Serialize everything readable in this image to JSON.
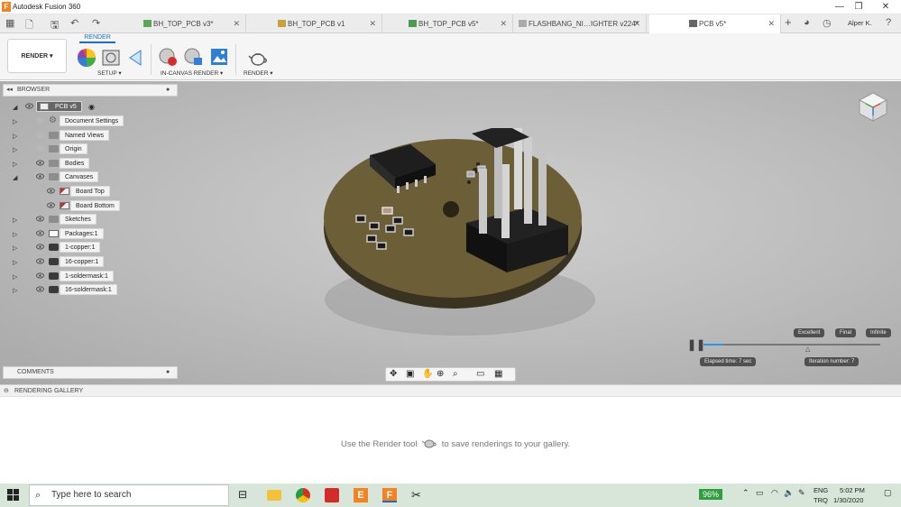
{
  "window": {
    "title": "Autodesk Fusion 360",
    "user": "Alper K.",
    "controls": [
      "—",
      "❐",
      "✕"
    ]
  },
  "tabs": [
    {
      "label": "BH_TOP_PCB v3*",
      "active": false
    },
    {
      "label": "BH_TOP_PCB v1",
      "active": false
    },
    {
      "label": "BH_TOP_PCB v5*",
      "active": false
    },
    {
      "label": "FLASHBANG_NI…IGHTER v224*",
      "active": false
    },
    {
      "label": "PCB v5*",
      "active": true
    }
  ],
  "ribbon": {
    "workspace": "RENDER ▾",
    "active_tab": "RENDER",
    "groups": [
      "SETUP ▾",
      "IN-CANVAS RENDER ▾",
      "RENDER ▾"
    ]
  },
  "browser": {
    "title": "BROWSER",
    "root": "PCB v5",
    "nodes": [
      {
        "label": "Document Settings",
        "icon": "gear-icon"
      },
      {
        "label": "Named Views",
        "icon": "folder-icon"
      },
      {
        "label": "Origin",
        "icon": "folder-icon"
      },
      {
        "label": "Bodies",
        "icon": "folder-icon"
      },
      {
        "label": "Canvases",
        "icon": "folder-icon"
      },
      {
        "label": "Board Top",
        "icon": "canvas-icon"
      },
      {
        "label": "Board Bottom",
        "icon": "canvas-icon"
      },
      {
        "label": "Sketches",
        "icon": "folder-icon"
      },
      {
        "label": "Packages:1",
        "icon": "component-icon"
      },
      {
        "label": "1-copper:1",
        "icon": "body-icon"
      },
      {
        "label": "16-copper:1",
        "icon": "body-icon"
      },
      {
        "label": "1-soldermask:1",
        "icon": "body-icon"
      },
      {
        "label": "16-soldermask:1",
        "icon": "body-icon"
      }
    ]
  },
  "comments": {
    "title": "COMMENTS"
  },
  "render_progress": {
    "levels": [
      "Excellent",
      "Final",
      "Infinite"
    ],
    "elapsed": "Elapsed time: 7 sec",
    "iteration": "Iteration number: 7",
    "progress_fraction": 0.11
  },
  "gallery": {
    "title": "RENDERING GALLERY",
    "message_before": "Use the Render tool",
    "message_after": "to save renderings to your gallery."
  },
  "taskbar": {
    "search_placeholder": "Type here to search",
    "battery": "96%",
    "lang_top": "ENG",
    "lang_bottom": "TRQ",
    "time": "5:02 PM",
    "date": "1/30/2020"
  },
  "colors": {
    "accent": "#1a6ec9",
    "taskbar": "#d8e6da",
    "battery": "#2e9e3e",
    "app": "#f58220"
  }
}
